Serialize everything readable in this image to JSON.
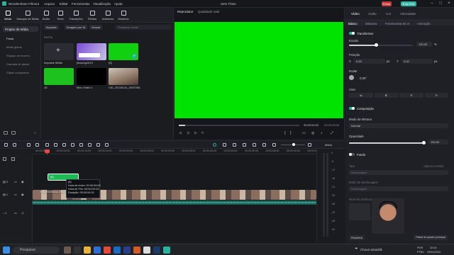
{
  "app": {
    "title": "Wondershare Filmora",
    "menu": [
      "Arquivo",
      "Editar",
      "Ferramentas",
      "Visualização",
      "Ajuda"
    ],
    "project_title": "Sem Título",
    "entrar": "Entrar",
    "export": "Exportar"
  },
  "toolbar": {
    "tools": [
      {
        "label": "Mídia",
        "icon": "media-icon"
      },
      {
        "label": "Estoque de Mídia",
        "icon": "stock-icon"
      },
      {
        "label": "Áudio",
        "icon": "audio-icon"
      },
      {
        "label": "Texto",
        "icon": "text-icon"
      },
      {
        "label": "Transições",
        "icon": "transitions-icon"
      },
      {
        "label": "Efeitos",
        "icon": "effects-icon"
      },
      {
        "label": "Adesivos",
        "icon": "stickers-icon"
      },
      {
        "label": "Modelos",
        "icon": "templates-icon"
      }
    ]
  },
  "sidebar": {
    "header": "Projeto de Mídia",
    "items": [
      "Pasta",
      "Mídia global",
      "Espaço na nuvem...",
      "Camada de ajuste",
      "Clipes compostos"
    ]
  },
  "media": {
    "importar": "Importar",
    "imagem_ia": "Imagem por IA",
    "gravar": "Gravar",
    "search_placeholder": "Pesquisar mídia",
    "folder_label": "PASTA",
    "items": [
      {
        "label": "Importar Mídia"
      },
      {
        "label": "jmacing2013"
      },
      {
        "label": "(8)"
      },
      {
        "label": "16"
      },
      {
        "label": "Meu Vídeo 1"
      },
      {
        "label": "VID_20240114_0937050..."
      }
    ]
  },
  "player": {
    "tab_player": "Reprodutor",
    "tab_quality": "Qualidade total",
    "timecode_current": "00:00:00:00",
    "timecode_total": "00:00:05:00",
    "progress": 0.05
  },
  "right": {
    "tabs": [
      "Vídeo",
      "Áudio",
      "Cor",
      "Velocidade"
    ],
    "subtabs": [
      "Básico",
      "Máscara",
      "Ferramentas de IA",
      "Animação"
    ],
    "transform": "Transformar",
    "scale_label": "Escala",
    "scale_value": "100,00",
    "scale_unit": "%",
    "position_label": "Posição",
    "pos_x_label": "X",
    "pos_x": "0,00",
    "pos_x_unit": "px",
    "pos_y_label": "Y",
    "pos_y": "0,00",
    "pos_y_unit": "px",
    "rotate_label": "Rodar",
    "rotate_value": "0,00°",
    "flip_label": "Virar",
    "composition": "Composição",
    "blend_label": "Modo de Mistura",
    "blend_value": "Normal",
    "opacity_label": "Opacidade",
    "opacity_value": "100,00",
    "fundo": "Fundo",
    "tipo_label": "Tipo",
    "tipo_value": "Desfocagem",
    "aplicar": "Aplicar a todos",
    "estilo_label": "Estilo de desfocagem",
    "estilo_value": "Desfocagem",
    "nivel_label": "Nível de desfocagem",
    "reset": "Redefinir",
    "keyframe_btn": "Painel de quadro principal"
  },
  "timeline": {
    "ruler": [
      "00:00:00:00",
      "00:00:05:00",
      "00:00:10:00",
      "00:00:15:00",
      "00:00:20:00",
      "00:00:25:00",
      "00:00:30:00",
      "00:00:35:00",
      "00:00:40:00",
      "00:00:45:00",
      "00:00:50:00",
      "00:00:55:00",
      "00:01:00:00",
      "00:01:05:00"
    ],
    "meter_label": "Metro",
    "meter_ticks": [
      "0",
      "-6",
      "-12",
      "-18",
      "-24",
      "-30",
      "-36",
      "-42",
      "-48",
      "-54"
    ],
    "clip2_label": "(8)",
    "clip1_label": "VID_20240114_093705"
  },
  "tooltip": {
    "title": "(8)",
    "start": "Hora de início: 00:00:05:00",
    "end": "Hora de Fim: 00:00:09:15",
    "duration": "Duração: 00:00:04:15"
  },
  "taskbar": {
    "search_placeholder": "Pesquisar",
    "weather": "Chuva amanhã",
    "lang": "POR",
    "layout": "PTB2",
    "time": "22:03",
    "date": "19/01/2024"
  },
  "colors": {
    "accent": "#2ab3a1",
    "green_screen": "#00e300",
    "playhead": "#e84747",
    "clip_green": "#1db954"
  }
}
